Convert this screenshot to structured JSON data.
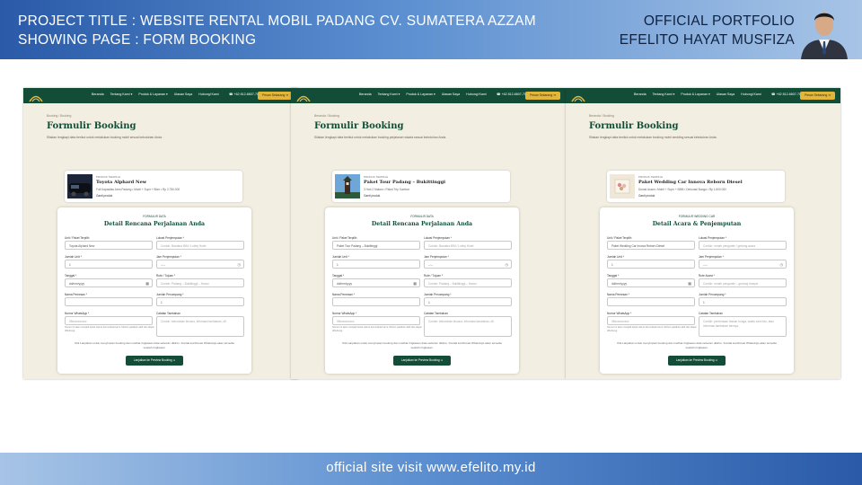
{
  "header": {
    "title_line1": "PROJECT TITLE : WEBSITE RENTAL MOBIL PADANG CV. SUMATERA AZZAM",
    "title_line2": "SHOWING PAGE : FORM BOOKING",
    "right_line1": "OFFICIAL PORTFOLIO",
    "right_line2": "EFELITO HAYAT MUSFIZA"
  },
  "footer": {
    "text": "official site visit www.efelito.my.id"
  },
  "nav": {
    "menu": [
      "Beranda",
      "Tentang Kami ▾",
      "Produk & Layanan ▾",
      "Ulasan Saya",
      "Hubungi Kami"
    ],
    "phone": "☎ +62 812-6607-7060",
    "button": "Pesan Sekarang ➔"
  },
  "colors": {
    "brand_green": "#134d37",
    "accent_gold": "#e3b63a",
    "page_bg": "#f3eee2"
  },
  "screens": [
    {
      "breadcrumb": "Booking / Booking",
      "title": "Formulir Booking",
      "subtitle": "Silakan lengkapi data berikut untuk melakukan booking mobil sesuai kebutuhan Anda.",
      "product": {
        "category": "PRODUK TERPILIH",
        "name": "Toyota Alphard New",
        "desc": "Full Kapasitas Area Padang • Mobil + Supir + Bbm • Rp 2.750.000",
        "link": "Ganti produk"
      },
      "form": {
        "tag": "FORMULIR DATA",
        "title": "Detail Rencana Perjalanan Anda",
        "fields": [
          {
            "label": "Unit / Paket Terpilih",
            "value": "Toyota Alphard New",
            "ph": false
          },
          {
            "label": "Lokasi Penjemputan *",
            "value": "Contoh: Bandara BIM / Lobby Hotel",
            "ph": true
          },
          {
            "label": "Jumlah Unit *",
            "value": "1",
            "ph": false
          },
          {
            "label": "Jam Penjemputan *",
            "value": "--:--",
            "ph": false,
            "icon": "◷"
          },
          {
            "label": "Tanggal *",
            "value": "dd/mm/yyyy",
            "ph": false,
            "icon": "▦"
          },
          {
            "label": "Rute / Tujuan *",
            "value": "Contoh: Padang – Bukittinggi – Harau",
            "ph": true
          },
          {
            "label": "Nama Pemesan *",
            "value": "",
            "ph": false
          },
          {
            "label": "Jumlah Penumpang *",
            "value": "1",
            "ph": false
          },
          {
            "label": "Nomor WhatsApp *",
            "value": "08xxxxxxxxxx",
            "ph": true,
            "hint": "Nomor ini akan menjadi kanal utama komunikasi kami. Mohon pastikan aktif dan dapat dihubungi."
          },
          {
            "label": "Catatan Tambahan",
            "value": "Contoh: kebutuhan khusus, informasi tambahan, dll.",
            "ph": true,
            "textarea": true
          }
        ],
        "note": "Klik Lanjutkan untuk menyimpan booking dan melihat ringkasan data sebelum dikirim. Kontak konfirmasi WhatsApp akan tersedia setelah ringkasan.",
        "submit": "Lanjutkan ke Preview Booking ➔"
      }
    },
    {
      "breadcrumb": "Beranda / Booking",
      "title": "Formulir Booking",
      "subtitle": "Silakan lengkapi data berikut untuk melakukan booking perjalanan wisata sesuai kebutuhan Anda.",
      "product": {
        "category": "PRODUK TERPILIH",
        "name": "Paket Tour Padang – Bukittinggi",
        "desc": "3 Hari 2 Malam • Paket Trip Sumbar",
        "link": "Ganti produk"
      },
      "form": {
        "tag": "FORMULIR DATA",
        "title": "Detail Rencana Perjalanan Anda",
        "fields": [
          {
            "label": "Unit / Paket Terpilih",
            "value": "Paket Tour Padang – Bukittinggi",
            "ph": false
          },
          {
            "label": "Lokasi Penjemputan *",
            "value": "Contoh: Bandara BIM / Lobby Hotel",
            "ph": true
          },
          {
            "label": "Jumlah Unit *",
            "value": "1",
            "ph": false
          },
          {
            "label": "Jam Penjemputan *",
            "value": "--:--",
            "ph": false,
            "icon": "◷"
          },
          {
            "label": "Tanggal *",
            "value": "dd/mm/yyyy",
            "ph": false,
            "icon": "▦"
          },
          {
            "label": "Rute / Tujuan *",
            "value": "Contoh: Padang – Bukittinggi – Harau",
            "ph": true
          },
          {
            "label": "Nama Pemesan *",
            "value": "",
            "ph": false
          },
          {
            "label": "Jumlah Penumpang *",
            "value": "1",
            "ph": false
          },
          {
            "label": "Nomor WhatsApp *",
            "value": "08xxxxxxxxxx",
            "ph": true,
            "hint": "Nomor ini akan menjadi kanal utama komunikasi kami. Mohon pastikan aktif dan dapat dihubungi."
          },
          {
            "label": "Catatan Tambahan",
            "value": "Contoh: kebutuhan khusus, informasi tambahan, dll.",
            "ph": true,
            "textarea": true
          }
        ],
        "note": "Klik Lanjutkan untuk menyimpan booking dan melihat ringkasan data sebelum dikirim. Kontak konfirmasi WhatsApp akan tersedia setelah ringkasan.",
        "submit": "Lanjutkan ke Preview Booking ➔"
      }
    },
    {
      "breadcrumb": "Beranda / Booking",
      "title": "Formulir Booking",
      "subtitle": "Silakan lengkapi data berikut untuk melakukan booking mobil wedding sesuai kebutuhan Anda.",
      "product": {
        "category": "PRODUK TERPILIH",
        "name": "Paket Wedding Car Innova Reborn Diesel",
        "desc": "Durasi Acara • Mobil + Sopir + BBM • Dekorasi Bunga • Rp 1.800.000",
        "link": "Ganti produk"
      },
      "form": {
        "tag": "FORMULIR WEDDING CAR",
        "title": "Detail Acara & Penjemputan",
        "fields": [
          {
            "label": "Unit / Paket Terpilih",
            "value": "Paket Wedding Car Innova Reborn Diesel",
            "ph": false
          },
          {
            "label": "Lokasi Penjemputan *",
            "value": "Contoh: rumah pengantin / gedung acara",
            "ph": true
          },
          {
            "label": "Jumlah Unit *",
            "value": "1",
            "ph": false
          },
          {
            "label": "Jam Penjemputan *",
            "value": "--:--",
            "ph": false,
            "icon": "◷"
          },
          {
            "label": "Tanggal *",
            "value": "dd/mm/yyyy",
            "ph": false,
            "icon": "▦"
          },
          {
            "label": "Rute Acara *",
            "value": "Contoh: rumah pengantin – gedung resepsi",
            "ph": true
          },
          {
            "label": "Nama Pemesan *",
            "value": "",
            "ph": false
          },
          {
            "label": "Jumlah Penumpang *",
            "value": "1",
            "ph": false
          },
          {
            "label": "Nomor WhatsApp *",
            "value": "08xxxxxxxxxx",
            "ph": true,
            "hint": "Nomor ini akan menjadi kanal utama komunikasi kami. Mohon pastikan aktif dan dapat dihubungi."
          },
          {
            "label": "Catatan Tambahan",
            "value": "Contoh: permintaan hiasan bunga, waktu sesi foto, atau informasi tambahan lainnya.",
            "ph": true,
            "textarea": true
          }
        ],
        "note": "Klik Lanjutkan untuk menyimpan booking dan melihat ringkasan data sebelum dikirim. Kontak konfirmasi WhatsApp akan tersedia setelah ringkasan.",
        "submit": "Lanjutkan ke Preview Booking ➔"
      }
    }
  ]
}
